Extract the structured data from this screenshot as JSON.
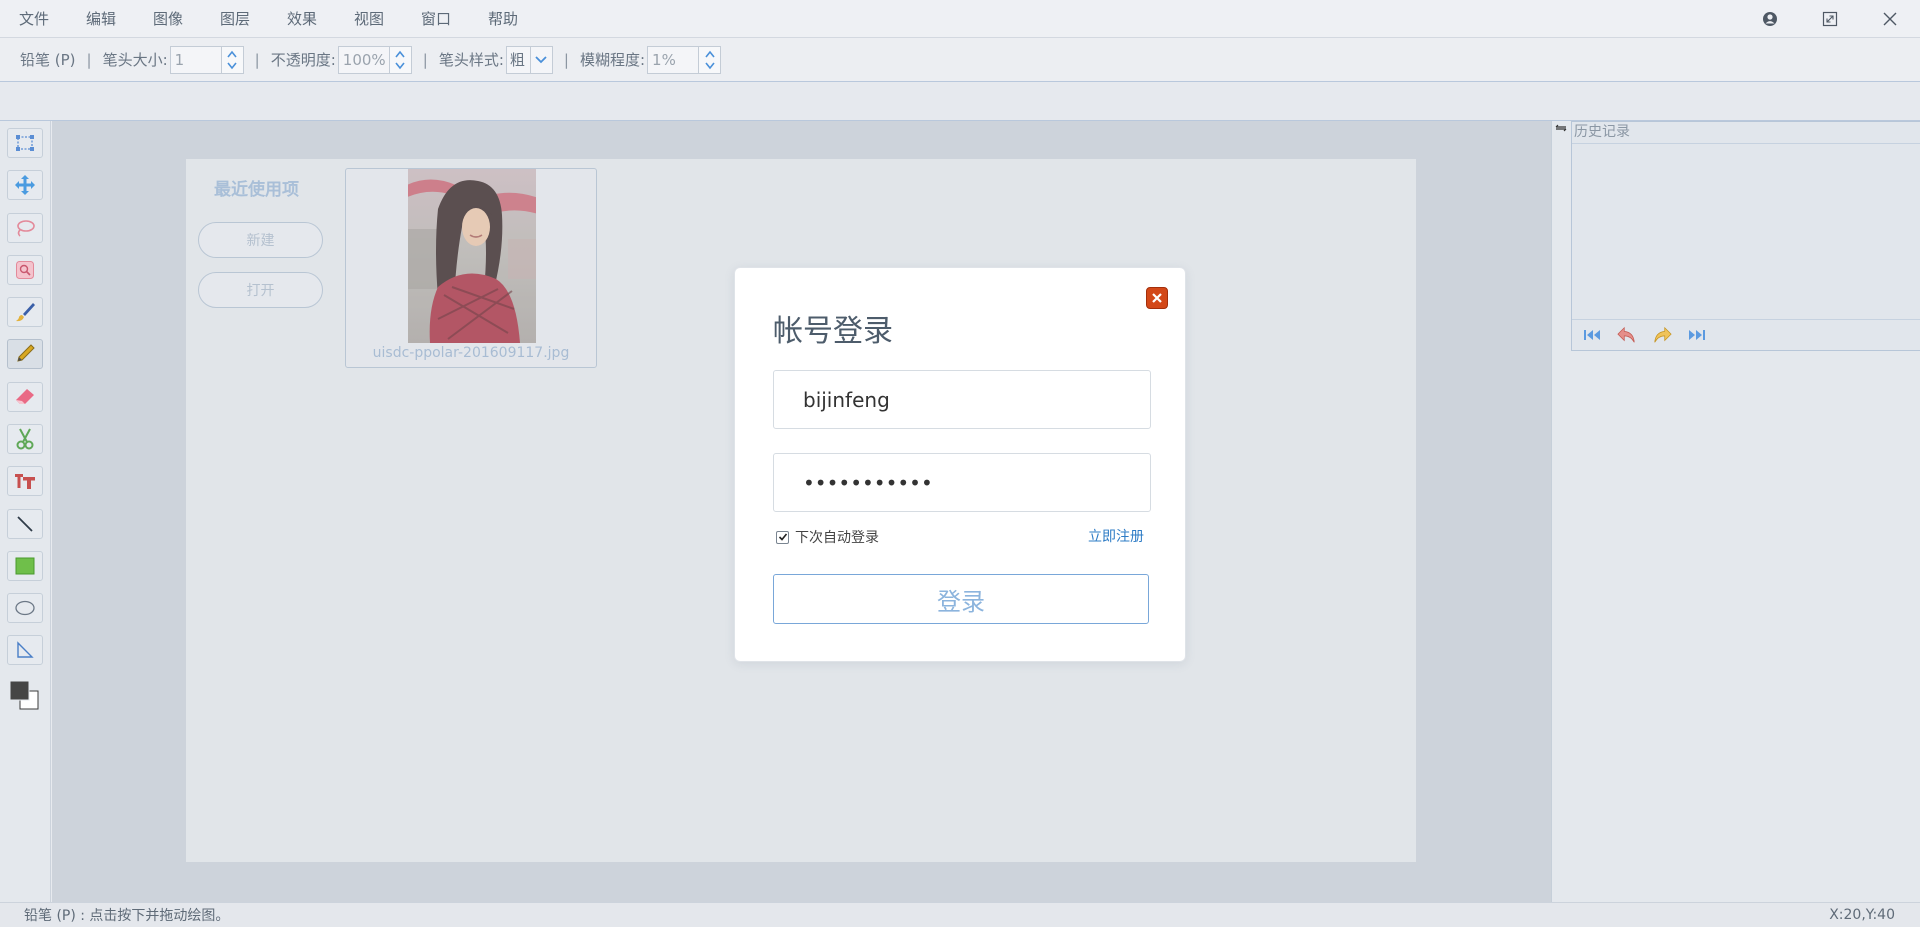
{
  "menubar": {
    "items": [
      "文件",
      "编辑",
      "图像",
      "图层",
      "效果",
      "视图",
      "窗口",
      "帮助"
    ]
  },
  "window_controls": [
    "user-icon",
    "maximize-icon",
    "close-icon"
  ],
  "optionbar": {
    "tool_label": "铅笔 (P)",
    "sep": "|",
    "brush_size_label": "笔头大小:",
    "brush_size_value": "1",
    "opacity_label": "不透明度:",
    "opacity_value": "100%",
    "brush_style_label": "笔头样式:",
    "brush_style_value": "粗",
    "blur_label": "模糊程度:",
    "blur_value": "1%"
  },
  "tools": [
    "rectangle-select-icon",
    "move-icon",
    "lasso-icon",
    "magic-select-icon",
    "brush-icon",
    "pencil-icon",
    "eraser-icon",
    "scissors-icon",
    "text-icon",
    "line-icon",
    "rectangle-fill-icon",
    "ellipse-icon",
    "triangle-icon",
    "color-swatch-icon"
  ],
  "workspace": {
    "recent_title": "最近使用项",
    "new_label": "新建",
    "open_label": "打开",
    "recent_file_name": "uisdc-ppolar-201609117.jpg"
  },
  "history_panel": {
    "title": "历史记录",
    "controls": [
      "first-step-icon",
      "undo-icon",
      "redo-icon",
      "last-step-icon"
    ]
  },
  "statusbar": {
    "hint": "铅笔 (P) :  点击按下并拖动绘图。",
    "coords": "X:20,Y:40"
  },
  "login_dialog": {
    "title": "帐号登录",
    "username_value": "bijinfeng",
    "password_value": "•••••••••••",
    "remember_label": "下次自动登录",
    "remember_checked": true,
    "register_link": "立即注册",
    "login_button": "登录",
    "close_color": "#d34818",
    "accent_color": "#2e7cc6"
  }
}
